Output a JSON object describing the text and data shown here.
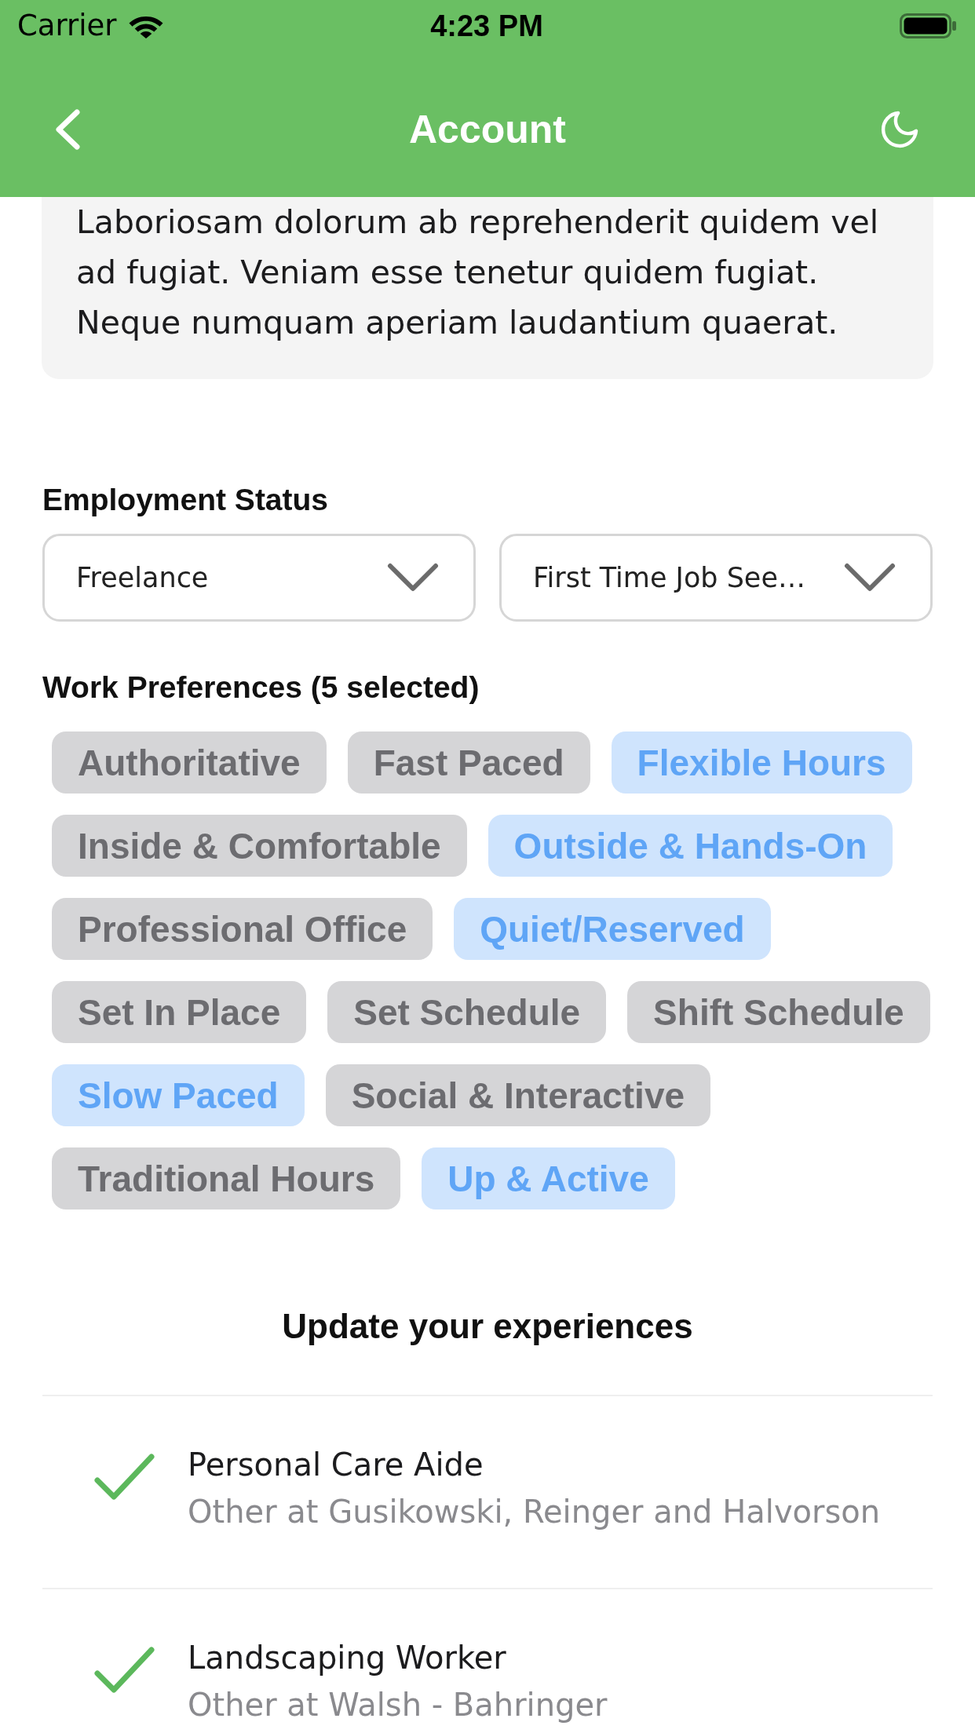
{
  "status_bar": {
    "carrier": "Carrier",
    "time": "4:23 PM"
  },
  "header": {
    "title": "Account"
  },
  "about": {
    "text": "Laboriosam dolorum ab reprehenderit quidem vel ad fugiat. Veniam esse tenetur quidem fugiat. Neque numquam aperiam laudantium quaerat."
  },
  "employment_status": {
    "label": "Employment Status",
    "dropdowns": [
      {
        "value": "Freelance"
      },
      {
        "value": "First Time Job See…"
      }
    ]
  },
  "work_preferences": {
    "label": "Work Preferences (5 selected)",
    "chips": [
      {
        "label": "Authoritative",
        "selected": false
      },
      {
        "label": "Fast Paced",
        "selected": false
      },
      {
        "label": "Flexible Hours",
        "selected": true
      },
      {
        "label": "Inside & Comfortable",
        "selected": false
      },
      {
        "label": "Outside & Hands-On",
        "selected": true
      },
      {
        "label": "Professional Office",
        "selected": false
      },
      {
        "label": "Quiet/Reserved",
        "selected": true
      },
      {
        "label": "Set In Place",
        "selected": false
      },
      {
        "label": "Set Schedule",
        "selected": false
      },
      {
        "label": "Shift Schedule",
        "selected": false
      },
      {
        "label": "Slow Paced",
        "selected": true
      },
      {
        "label": "Social & Interactive",
        "selected": false
      },
      {
        "label": "Traditional Hours",
        "selected": false
      },
      {
        "label": "Up & Active",
        "selected": true
      }
    ]
  },
  "experiences": {
    "title": "Update your experiences",
    "items": [
      {
        "title": "Personal Care Aide",
        "subtitle": "Other at Gusikowski, Reinger and Halvorson",
        "checked": true
      },
      {
        "title": "Landscaping Worker",
        "subtitle": "Other at Walsh - Bahringer",
        "checked": true
      }
    ]
  }
}
